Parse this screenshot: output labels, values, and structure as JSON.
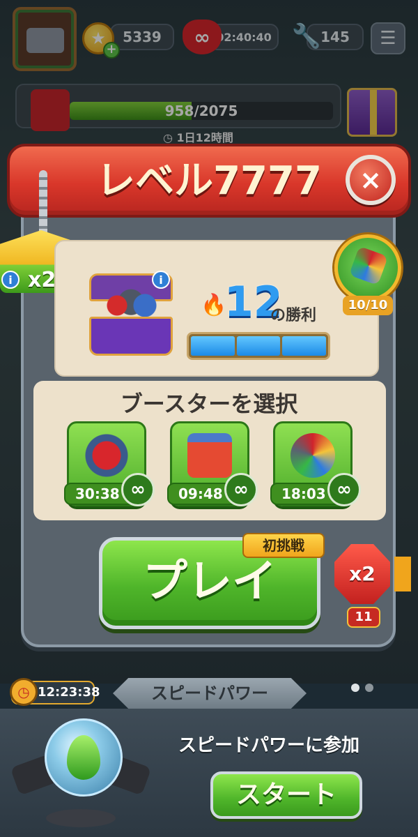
{
  "hud": {
    "coins": "5339",
    "lives_timer": "02:40:40",
    "tools": "145",
    "icons": {
      "avatar": "truck-avatar-icon",
      "coin": "star-coin-icon",
      "add": "plus-icon",
      "lives": "infinity-heart-icon",
      "tools": "wrench-icon",
      "menu": "menu-icon"
    }
  },
  "event": {
    "progress_text": "958/2075",
    "progress_fraction": 0.4617,
    "timer": "1日12時間",
    "icons": {
      "fuel": "fuel-can-icon",
      "reward": "gift-box-icon",
      "clock": "clock-icon"
    }
  },
  "modal": {
    "title": "レベル7777",
    "close_icon": "×",
    "multiplier_tag": "x2",
    "info_icon": "i",
    "streak": {
      "count": "12",
      "label": "の勝利",
      "flame_icon": "blue-flame-icon",
      "segments_filled": 3,
      "segments_total": 3
    },
    "gem_badge": {
      "count": "10/10",
      "icon": "gem-cluster-icon"
    },
    "boosters_title": "ブースターを選択",
    "boosters": [
      {
        "name": "rocket-booster",
        "time": "30:38",
        "infinity": "∞",
        "icon": "double-rocket-icon"
      },
      {
        "name": "dynamite-booster",
        "time": "09:48",
        "infinity": "∞",
        "icon": "dynamite-icon"
      },
      {
        "name": "gem-booster",
        "time": "18:03",
        "infinity": "∞",
        "icon": "gem-ball-icon"
      }
    ],
    "play_label": "プレイ",
    "first_try_label": "初挑戦",
    "multiplier_badge": {
      "label": "x2",
      "count": "11"
    }
  },
  "bottom": {
    "timer": "12:23:38",
    "tab_label": "スピードパワー",
    "page_dots": 2,
    "active_dot": 0,
    "join_text": "スピードパワーに参加",
    "start_label": "スタート",
    "orb_icon": "green-flame-orb-icon"
  },
  "colors": {
    "header_red": "#d9372a",
    "play_green": "#4fb52a",
    "panel_cream": "#ede1cb",
    "streak_blue": "#2f9bf0",
    "gold": "#f3b82c"
  }
}
